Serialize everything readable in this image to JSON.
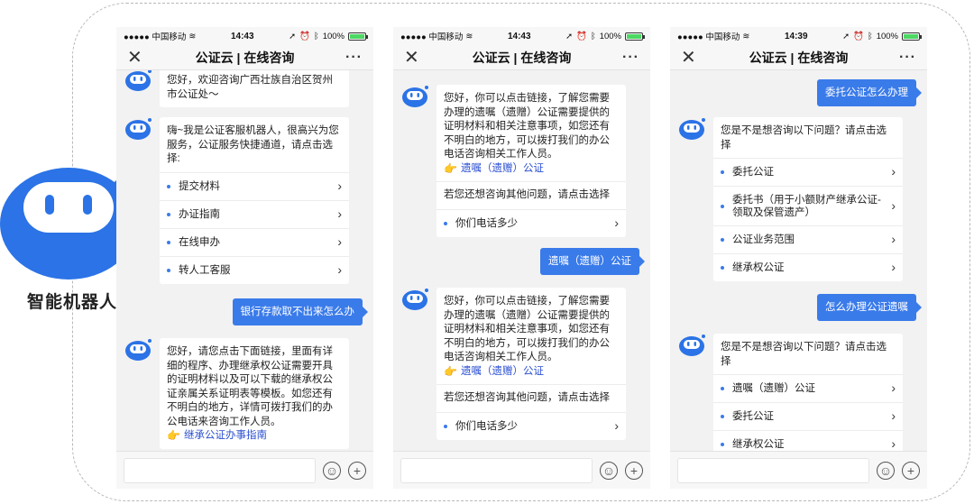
{
  "robot": {
    "label": "智能机器人"
  },
  "statusbar": {
    "carrier": "●●●●● 中国移动",
    "battery": "100%",
    "battery_level": 1.0
  },
  "phones": [
    {
      "time": "14:43",
      "title": "公证云 | 在线咨询",
      "messages": {
        "m1": "您好，欢迎咨询广西壮族自治区贺州市公证处～",
        "m2": "嗨~我是公证客服机器人，很高兴为您服务，公证服务快捷通道，请点击选择:",
        "m2_options": [
          "提交材料",
          "办证指南",
          "在线申办",
          "转人工客服"
        ],
        "user1": "银行存款取不出来怎么办",
        "m3": "您好，请您点击下面链接，里面有详细的程序、办理继承权公证需要开具的证明材料以及可以下载的继承权公证亲属关系证明表等模板。如您还有不明白的地方，详情可拨打我们的办公电话来咨询工作人员。",
        "m3_link": "继承公证办事指南"
      }
    },
    {
      "time": "14:43",
      "title": "公证云 | 在线咨询",
      "messages": {
        "m1": "您好，你可以点击链接，了解您需要办理的遗嘱（遗赠）公证需要提供的证明材料和相关注意事项，如您还有不明白的地方，可以拨打我们的办公电话咨询相关工作人员。",
        "m1_link": "遗嘱（遗赠）公证",
        "m1_sub": "若您还想咨询其他问题，请点击选择",
        "m1_option": "你们电话多少",
        "user1": "遗嘱（遗赠）公证",
        "m2": "您好，你可以点击链接，了解您需要办理的遗嘱（遗赠）公证需要提供的证明材料和相关注意事项，如您还有不明白的地方，可以拨打我们的办公电话咨询相关工作人员。",
        "m2_link": "遗嘱（遗赠）公证",
        "m2_sub": "若您还想咨询其他问题，请点击选择",
        "m2_option": "你们电话多少"
      }
    },
    {
      "time": "14:39",
      "title": "公证云 | 在线咨询",
      "messages": {
        "user1": "委托公证怎么办理",
        "m1": "您是不是想咨询以下问题？请点击选择",
        "m1_options": [
          "委托公证",
          "委托书（用于小额财产继承公证-领取及保管遗产）",
          "公证业务范围",
          "继承权公证"
        ],
        "user2": "怎么办理公证遗嘱",
        "m2": "您是不是想咨询以下问题？请点击选择",
        "m2_options": [
          "遗嘱（遗赠）公证",
          "委托公证",
          "继承权公证"
        ]
      }
    }
  ]
}
